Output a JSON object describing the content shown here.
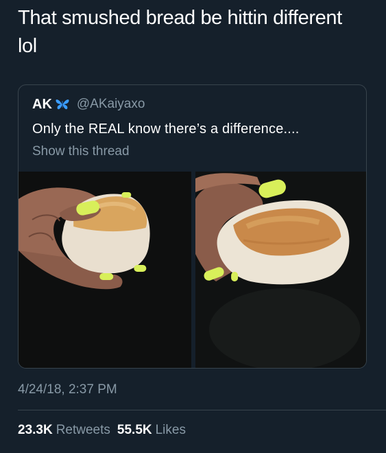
{
  "tweet": {
    "text": "That smushed bread be hittin different\nlol",
    "timestamp": "4/24/18, 2:37 PM"
  },
  "quote": {
    "name": "AK",
    "verified_icon": "butterfly-emoji-icon",
    "handle": "@AKaiyaxo",
    "text": "Only the REAL know there’s a difference....",
    "thread_link": "Show this thread",
    "photos": [
      {
        "name": "photo-whole-bread-roll"
      },
      {
        "name": "photo-smushed-bread-roll"
      }
    ]
  },
  "stats": {
    "retweets_count": "23.3K",
    "retweets_label": "Retweets",
    "likes_count": "55.5K",
    "likes_label": "Likes"
  },
  "colors": {
    "background": "#15202b",
    "text_primary": "#ffffff",
    "text_secondary": "#8899a6",
    "border": "#38444d",
    "nail_polish": "#d8ef5a"
  }
}
